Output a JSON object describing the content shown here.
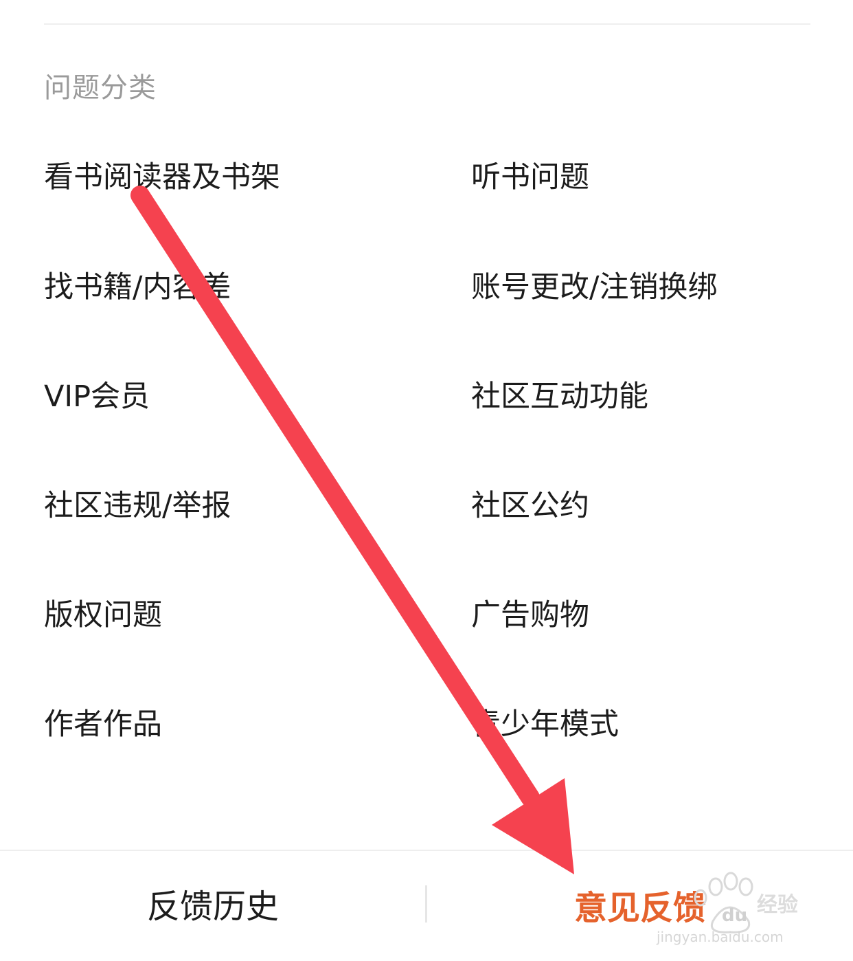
{
  "section": {
    "title": "问题分类"
  },
  "categories": [
    {
      "label": "看书阅读器及书架"
    },
    {
      "label": "听书问题"
    },
    {
      "label": "找书籍/内容差"
    },
    {
      "label": "账号更改/注销换绑"
    },
    {
      "label": "VIP会员"
    },
    {
      "label": "社区互动功能"
    },
    {
      "label": "社区违规/举报"
    },
    {
      "label": "社区公约"
    },
    {
      "label": "版权问题"
    },
    {
      "label": "广告购物"
    },
    {
      "label": "作者作品"
    },
    {
      "label": "青少年模式"
    }
  ],
  "bottom_bar": {
    "history_label": "反馈历史",
    "feedback_label": "意见反馈"
  },
  "watermark": {
    "brand": "Baidu经验",
    "url": "jingyan.baidu.com"
  },
  "annotation": {
    "arrow_color": "#f5424f",
    "accent_color": "#e5622c"
  }
}
